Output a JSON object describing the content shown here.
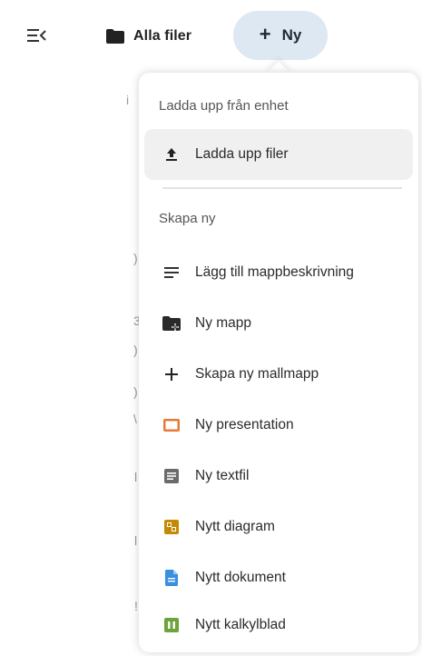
{
  "header": {
    "breadcrumb_label": "Alla filer",
    "new_button_plus": "+",
    "new_button_label": "Ny"
  },
  "background_fragments": [
    "i",
    ")",
    "3",
    ")",
    ")",
    "\\",
    "l",
    "l",
    "!"
  ],
  "menu": {
    "upload_section_title": "Ladda upp från enhet",
    "upload_item_label": "Ladda upp filer",
    "create_section_title": "Skapa ny",
    "items": [
      {
        "label": "Lägg till mappbeskrivning",
        "icon": "text-lines-icon"
      },
      {
        "label": "Ny mapp",
        "icon": "folder-plus-icon"
      },
      {
        "label": "Skapa ny mallmapp",
        "icon": "plus-icon"
      },
      {
        "label": "Ny presentation",
        "icon": "presentation-icon",
        "color": "#e8793a"
      },
      {
        "label": "Ny textfil",
        "icon": "textfile-icon",
        "color": "#6b6b6b"
      },
      {
        "label": "Nytt diagram",
        "icon": "diagram-icon",
        "color": "#c38a06"
      },
      {
        "label": "Nytt dokument",
        "icon": "document-icon",
        "color": "#3a8fe0"
      },
      {
        "label": "Nytt kalkylblad",
        "icon": "spreadsheet-icon",
        "color": "#6ca33a"
      }
    ]
  }
}
